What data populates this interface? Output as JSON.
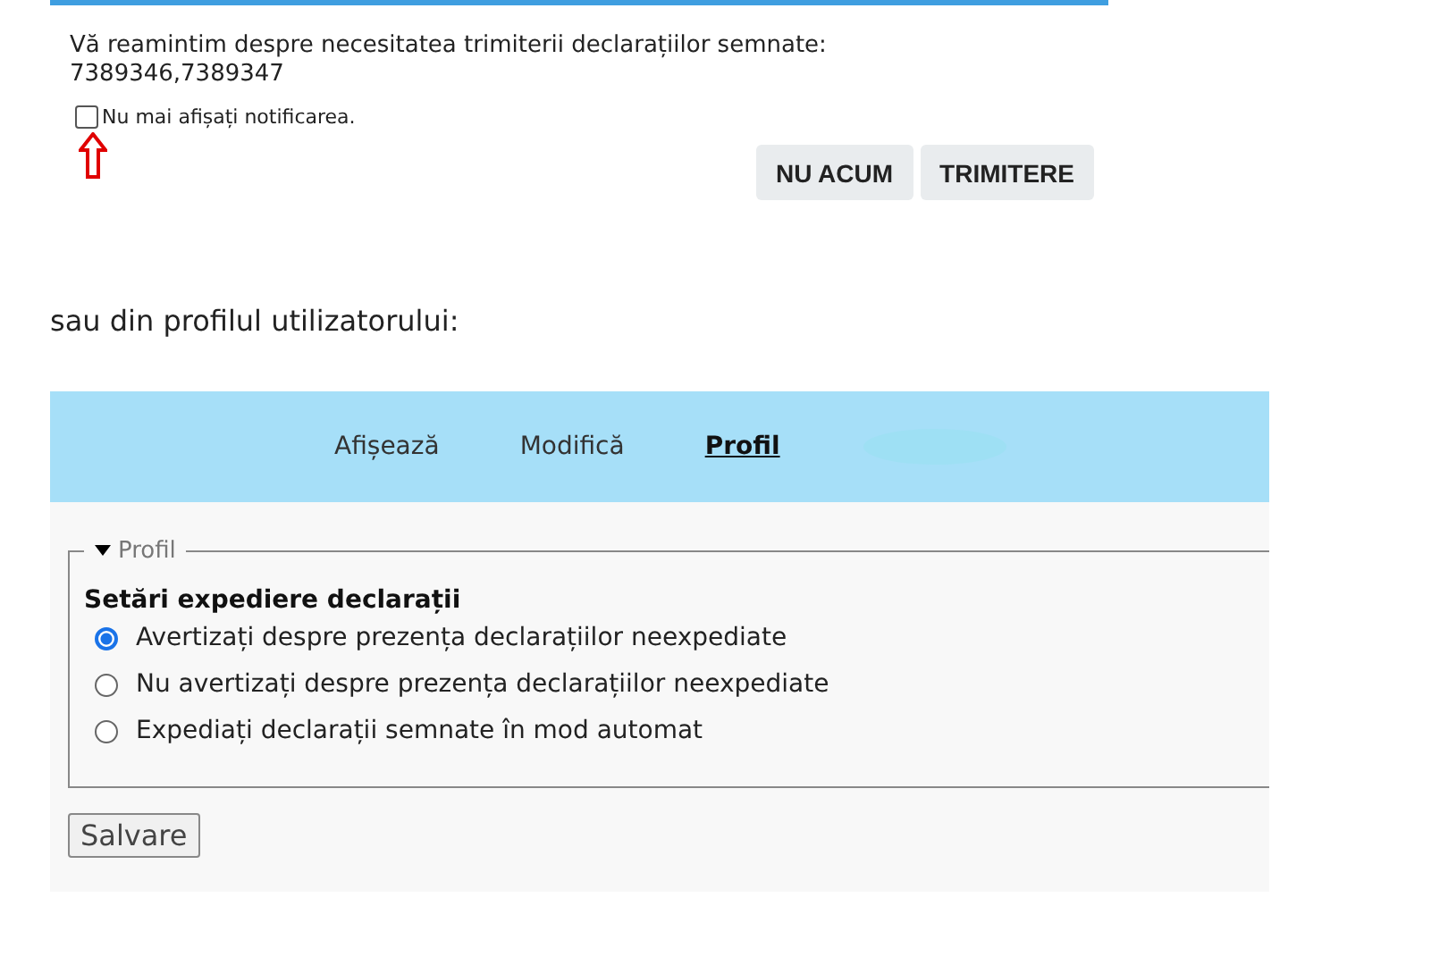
{
  "notification": {
    "message": "Vă reamintim despre necesitatea trimiterii declarațiilor semnate:",
    "ids": "7389346,7389347",
    "dont_show": {
      "label": "Nu mai afișați notificarea.",
      "checked": false
    },
    "buttons": [
      "NU ACUM",
      "TRIMITERE"
    ]
  },
  "intro": "sau din profilul utilizatorului:",
  "tabs": [
    {
      "label": "Afișează",
      "selected": false
    },
    {
      "label": "Modifică",
      "selected": false
    },
    {
      "label": "Profil",
      "selected": true
    }
  ],
  "profile": {
    "legend": "Profil",
    "expanded": true,
    "heading": "Setări expediere declarații",
    "options": [
      {
        "label": "Avertizați despre prezența declarațiilor neexpediate",
        "selected": true
      },
      {
        "label": "Nu avertizați despre prezența declarațiilor neexpediate",
        "selected": false
      },
      {
        "label": "Expediați declarații semnate în mod automat",
        "selected": false
      }
    ],
    "save": "Salvare"
  }
}
